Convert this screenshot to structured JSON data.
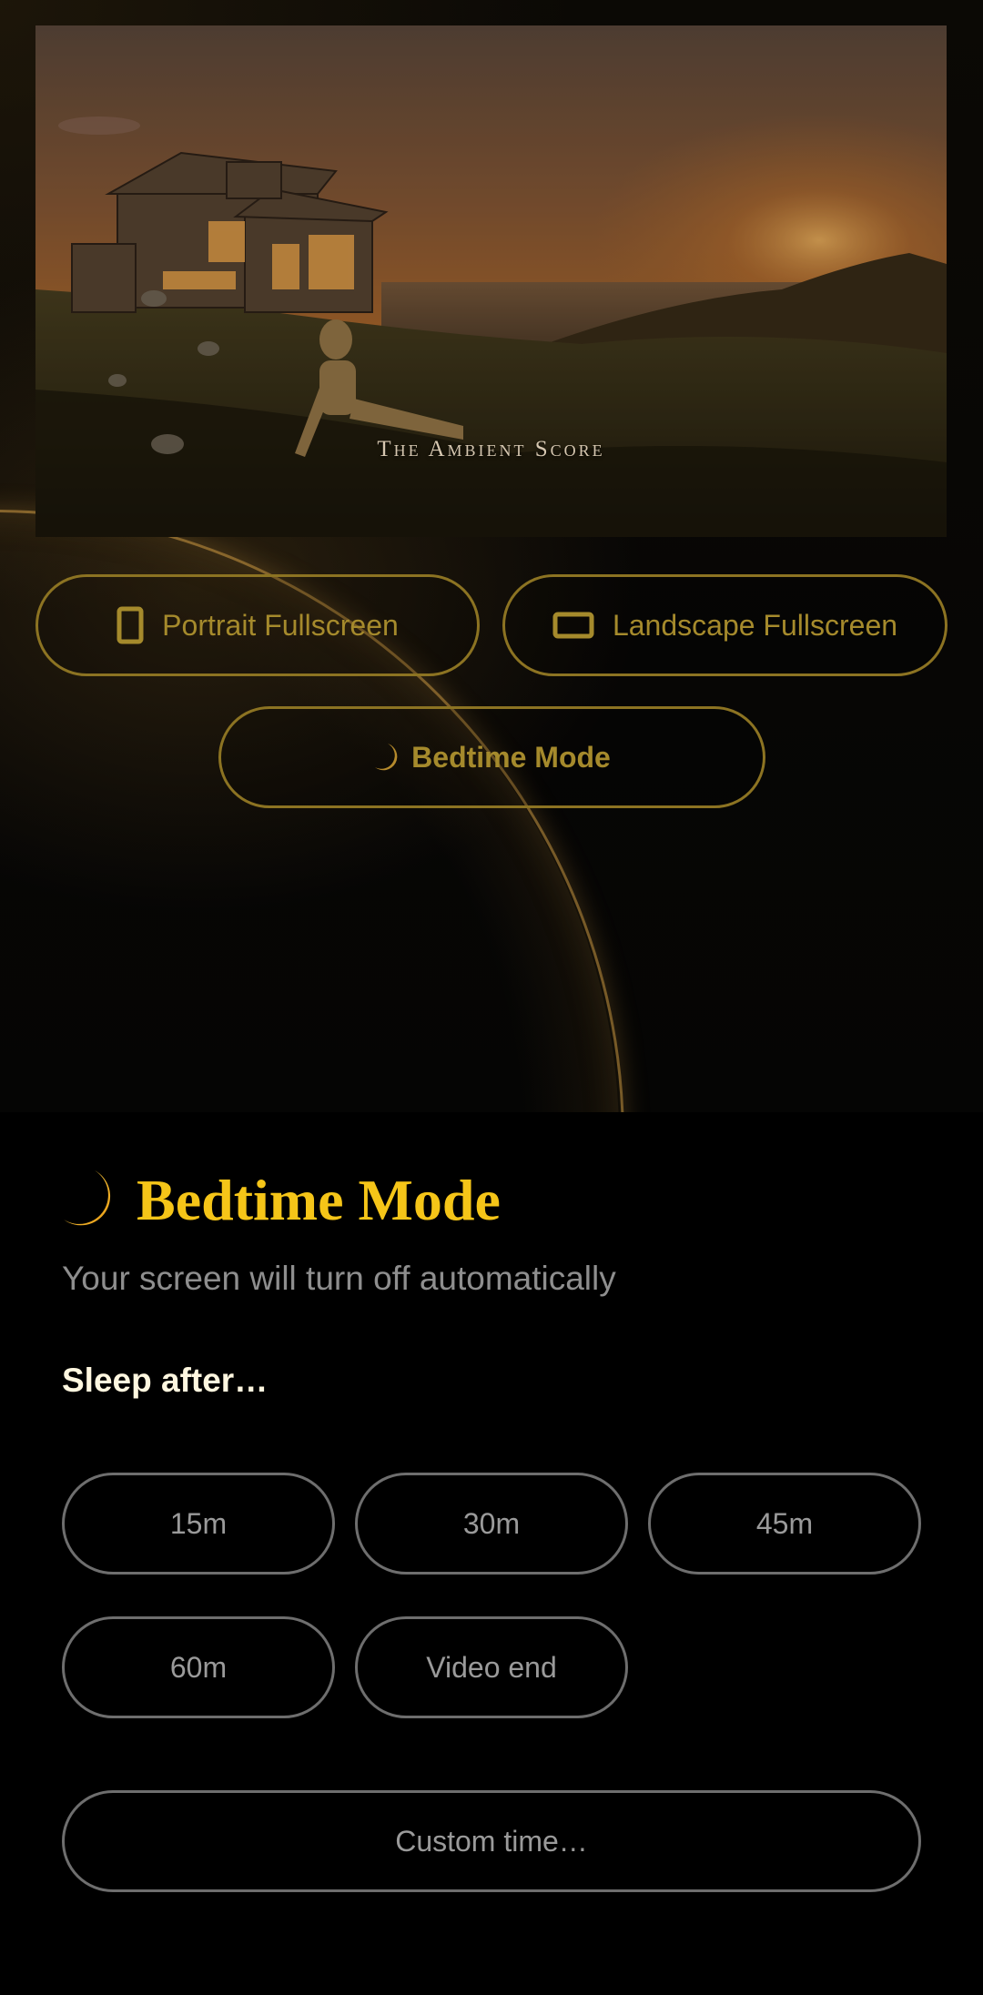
{
  "hero": {
    "title": "The Ambient Score"
  },
  "buttons": {
    "portrait_label": "Portrait Fullscreen",
    "landscape_label": "Landscape Fullscreen",
    "bedtime_label": "Bedtime Mode"
  },
  "sheet": {
    "title": "Bedtime Mode",
    "subtitle": "Your screen will turn off automatically",
    "sleep_label": "Sleep after…",
    "options": [
      "15m",
      "30m",
      "45m",
      "60m",
      "Video end"
    ],
    "custom_label": "Custom time…"
  },
  "colors": {
    "accent_gold": "#f5c518",
    "button_gold": "#a58a2c",
    "option_text": "#9a9a9a",
    "background": "#000000"
  },
  "icons": {
    "portrait": "phone-portrait-icon",
    "landscape": "phone-landscape-icon",
    "moon": "crescent-moon-icon"
  }
}
